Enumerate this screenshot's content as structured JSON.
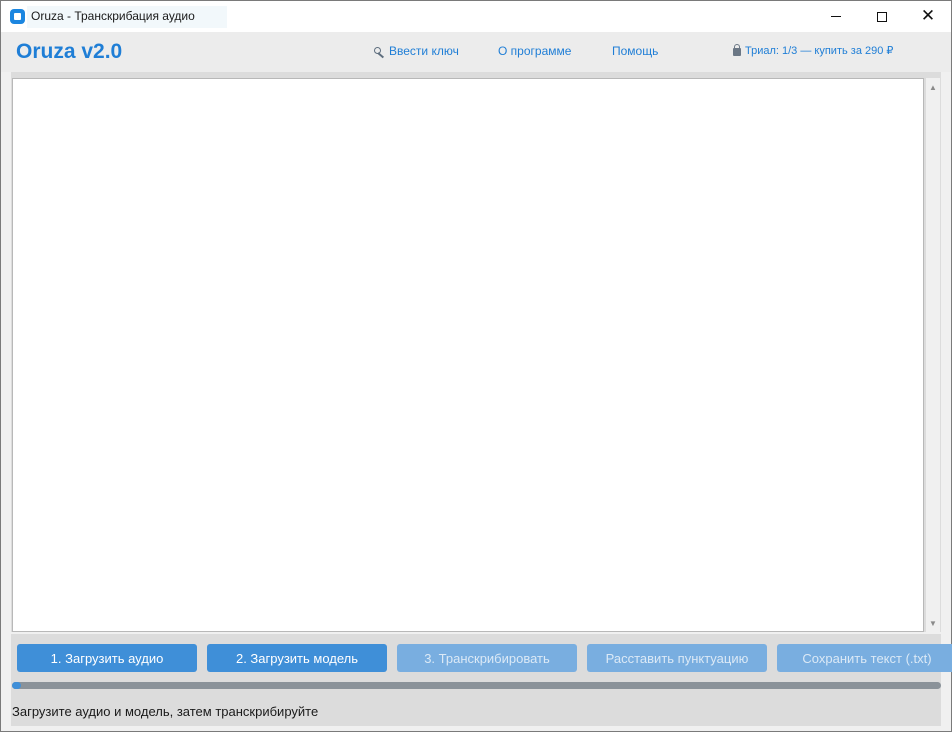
{
  "window": {
    "title": "Oruza - Транскрибация аудио"
  },
  "header": {
    "brand": "Oruza v2.0",
    "enter_key": "Ввести ключ",
    "about": "О программе",
    "help": "Помощь",
    "trial": "Триал: 1/3 — купить за 290 ₽"
  },
  "icons": {
    "app": "app-icon",
    "key": "key-icon",
    "lock": "lock-icon",
    "minimize": "minimize-icon",
    "maximize": "maximize-icon",
    "close": "close-icon"
  },
  "buttons": {
    "load_audio": "1. Загрузить аудио",
    "load_model": "2. Загрузить модель",
    "transcribe": "3. Транскрибировать",
    "punctuate": "Расставить пунктуацию",
    "save_text": "Сохранить текст (.txt)"
  },
  "progress": {
    "value_percent": 1
  },
  "status": {
    "message": "Загрузите аудио и модель, затем транскрибируйте"
  },
  "colors": {
    "accent": "#1f7ed6",
    "button_active": "#3f8fd8",
    "button_disabled": "#79aee0"
  }
}
